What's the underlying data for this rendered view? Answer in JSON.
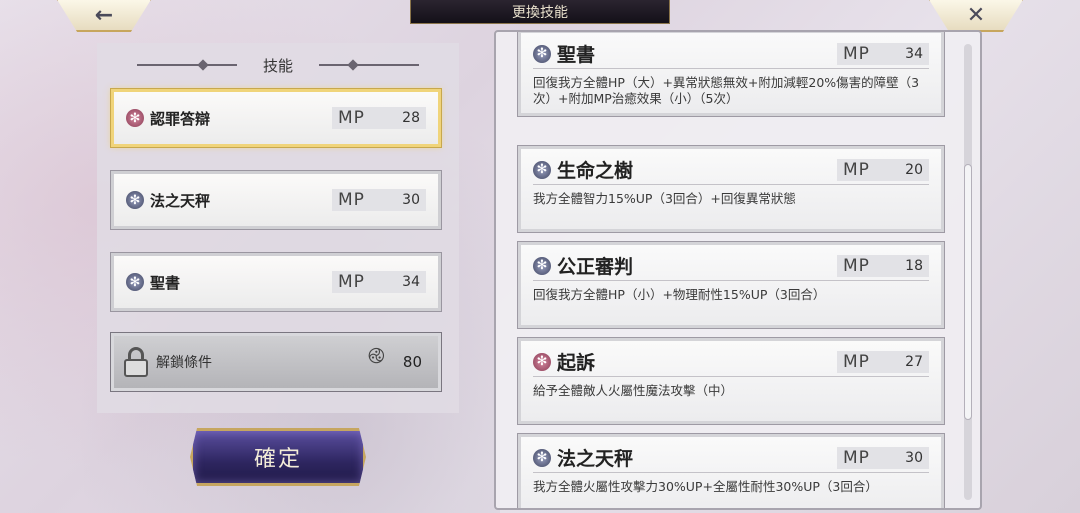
{
  "header": {
    "title": "更換技能",
    "back_icon": "←",
    "close_icon": "✕"
  },
  "left_panel": {
    "title": "技能",
    "slots": [
      {
        "name": "認罪答辯",
        "mp_label": "MP",
        "mp": "28",
        "gem": "red",
        "selected": true
      },
      {
        "name": "法之天秤",
        "mp_label": "MP",
        "mp": "30",
        "gem": "blue",
        "selected": false
      },
      {
        "name": "聖書",
        "mp_label": "MP",
        "mp": "34",
        "gem": "blue",
        "selected": false
      }
    ],
    "locked_slot": {
      "label": "解鎖條件",
      "icon": "swirl-icon",
      "cost": "80"
    },
    "confirm_label": "確定"
  },
  "skill_list": [
    {
      "name": "聖書",
      "mp_label": "MP",
      "mp": "34",
      "gem": "blue",
      "desc": "回復我方全體HP（大）+異常狀態無效+附加減輕20%傷害的障壁（3次）+附加MP治癒效果（小）（5次）"
    },
    {
      "name": "生命之樹",
      "mp_label": "MP",
      "mp": "20",
      "gem": "blue",
      "desc": "我方全體智力15%UP（3回合）+回復異常狀態"
    },
    {
      "name": "公正審判",
      "mp_label": "MP",
      "mp": "18",
      "gem": "blue",
      "desc": "回復我方全體HP（小）+物理耐性15%UP（3回合）"
    },
    {
      "name": "起訴",
      "mp_label": "MP",
      "mp": "27",
      "gem": "red",
      "desc": "給予全體敵人火屬性魔法攻擊（中）"
    },
    {
      "name": "法之天秤",
      "mp_label": "MP",
      "mp": "30",
      "gem": "blue",
      "desc": "我方全體火屬性攻擊力30%UP+全屬性耐性30%UP（3回合）"
    }
  ],
  "colors": {
    "accent_gold": "#c6a660",
    "confirm_purple": "#2e2660",
    "red_gem": "#8a3a54",
    "blue_gem": "#3e4460"
  }
}
